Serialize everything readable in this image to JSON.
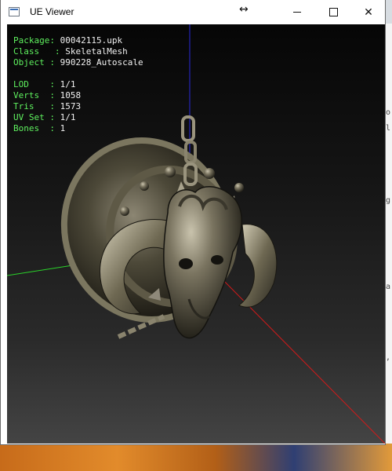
{
  "window": {
    "title": "UE Viewer",
    "icon": "app-window-icon",
    "controls": [
      "minimize-icon",
      "maximize-icon",
      "close-icon"
    ],
    "close_glyph": "✕",
    "resize_glyph": "↔"
  },
  "info": {
    "package_label": "Package",
    "package_value": "00042115.upk",
    "class_label": "Class",
    "class_value": "SkeletalMesh",
    "object_label": "Object",
    "object_value": "990228_Autoscale",
    "lod_label": "LOD",
    "lod_value": "1/1",
    "verts_label": "Verts",
    "verts_value": "1058",
    "tris_label": "Tris",
    "tris_value": "1573",
    "uvset_label": "UV Set",
    "uvset_value": "1/1",
    "bones_label": "Bones",
    "bones_value": "1"
  },
  "colors": {
    "info_label": "#5ef05e",
    "info_value": "#f0f0f0",
    "axis_x": "#d11a1a",
    "axis_y": "#2ad42a",
    "axis_z": "#2a2ad8"
  }
}
